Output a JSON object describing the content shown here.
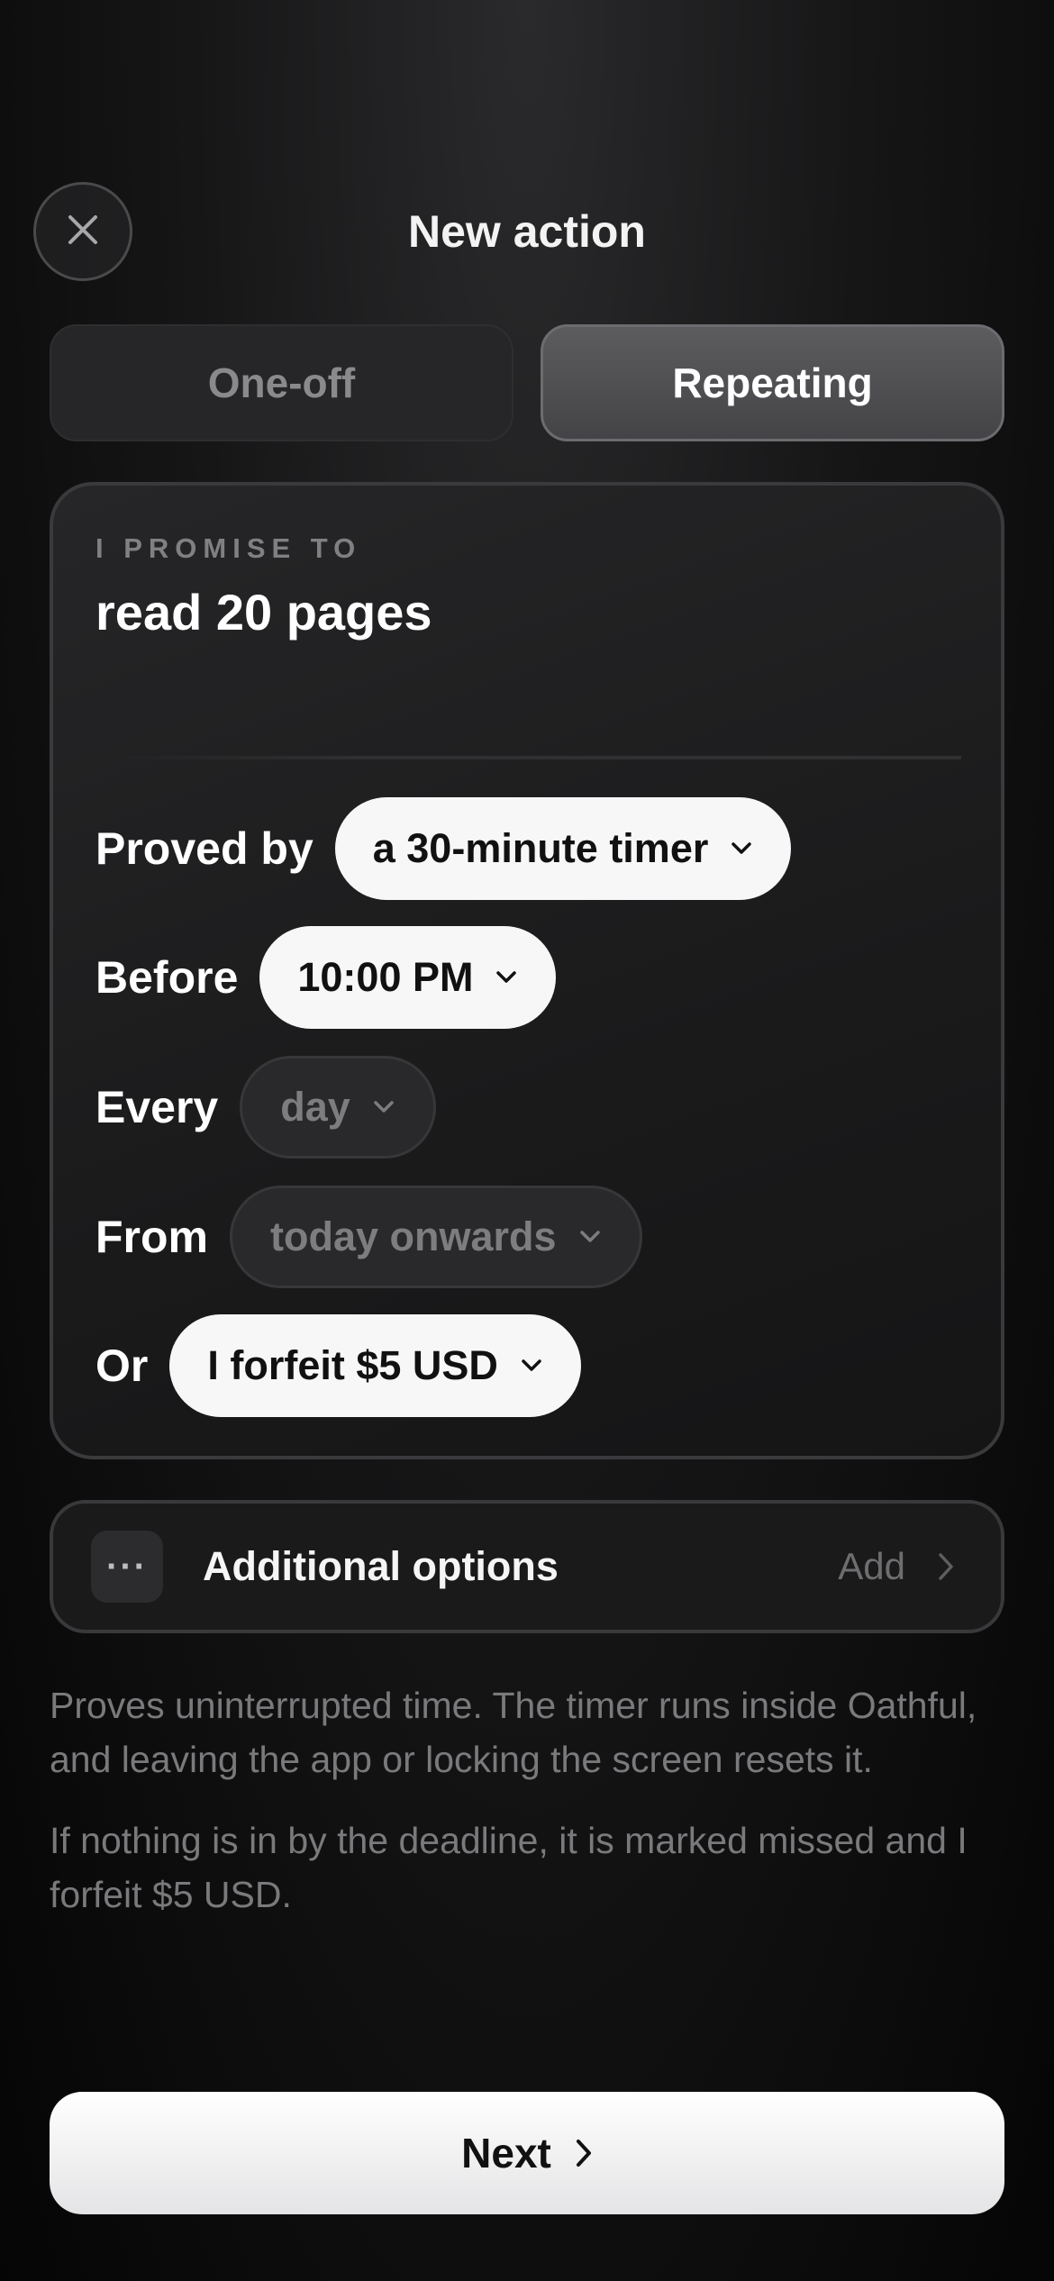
{
  "header": {
    "title": "New action",
    "close_icon": "close-icon"
  },
  "mode_tabs": {
    "one_off": "One-off",
    "repeating": "Repeating",
    "selected": "Repeating"
  },
  "promise": {
    "label": "I PROMISE TO",
    "text": "read 20 pages"
  },
  "rows": {
    "proved_by": {
      "label": "Proved by",
      "value": "a 30-minute timer"
    },
    "before": {
      "label": "Before",
      "value": "10:00 PM"
    },
    "every": {
      "label": "Every",
      "value": "day"
    },
    "from": {
      "label": "From",
      "value": "today onwards"
    },
    "or": {
      "label": "Or",
      "value": "I forfeit $5 USD"
    }
  },
  "additional_options": {
    "icon": "ellipsis-icon",
    "icon_glyph": "···",
    "label": "Additional options",
    "action": "Add"
  },
  "help": {
    "timer_text": "Proves uninterrupted time. The timer runs inside Oathful, and leaving the app or locking the screen resets it.",
    "deadline_text": "If nothing is in by the deadline, it is marked missed and I forfeit $5 USD."
  },
  "footer": {
    "next_label": "Next"
  },
  "colors": {
    "background": "#0a0a0a",
    "pill_light": "#f7f7f7",
    "pill_dark": "#29292b",
    "muted_text": "#7a7a7d"
  }
}
